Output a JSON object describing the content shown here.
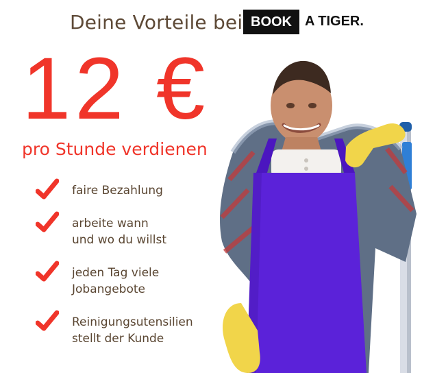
{
  "header": {
    "headline": "Deine Vorteile bei",
    "logo_box": "BOOK",
    "logo_text": "A TIGER."
  },
  "offer": {
    "price": "12 €",
    "subline": "pro Stunde verdienen"
  },
  "benefits": [
    {
      "text": "faire Bezahlung"
    },
    {
      "text": "arbeite wann\nund wo du willst"
    },
    {
      "text": "jeden Tag viele\nJobangebote"
    },
    {
      "text": "Reinigungsutensilien\nstellt der Kunde"
    }
  ],
  "colors": {
    "accent_red": "#f0352a",
    "text_brown": "#5a4632",
    "apron_purple": "#5b22d9",
    "glove_yellow": "#f1d54a"
  },
  "icons": [
    "check-icon",
    "worker-illustration"
  ]
}
